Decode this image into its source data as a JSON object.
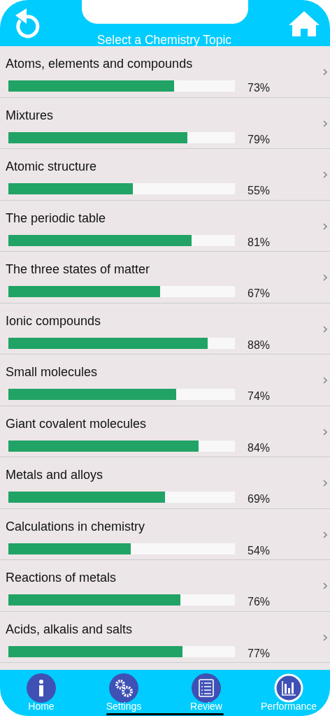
{
  "header": {
    "title": "Select a Chemistry Topic"
  },
  "topics": [
    {
      "name": "Atoms, elements and compounds",
      "level": 0.73,
      "percent": "73%"
    },
    {
      "name": "Mixtures",
      "level": 0.79,
      "percent": "79%"
    },
    {
      "name": "Atomic structure",
      "level": 0.55,
      "percent": "55%"
    },
    {
      "name": "The periodic table",
      "level": 0.81,
      "percent": "81%"
    },
    {
      "name": "The three states of matter",
      "level": 0.67,
      "percent": "67%"
    },
    {
      "name": "Ionic compounds",
      "level": 0.88,
      "percent": "88%"
    },
    {
      "name": "Small molecules",
      "level": 0.74,
      "percent": "74%"
    },
    {
      "name": "Giant covalent molecules",
      "level": 0.84,
      "percent": "84%"
    },
    {
      "name": "Metals and alloys",
      "level": 0.69,
      "percent": "69%"
    },
    {
      "name": "Calculations in chemistry",
      "level": 0.54,
      "percent": "54%"
    },
    {
      "name": "Reactions of metals",
      "level": 0.76,
      "percent": "76%"
    },
    {
      "name": "Acids, alkalis and salts",
      "level": 0.77,
      "percent": "77%"
    }
  ],
  "tabs": [
    {
      "kind": "info",
      "label": "Home",
      "selected": false
    },
    {
      "kind": "gears",
      "label": "Settings",
      "selected": false
    },
    {
      "kind": "list",
      "label": "Review",
      "selected": false
    },
    {
      "kind": "chart",
      "label": "Performance",
      "selected": true
    }
  ]
}
